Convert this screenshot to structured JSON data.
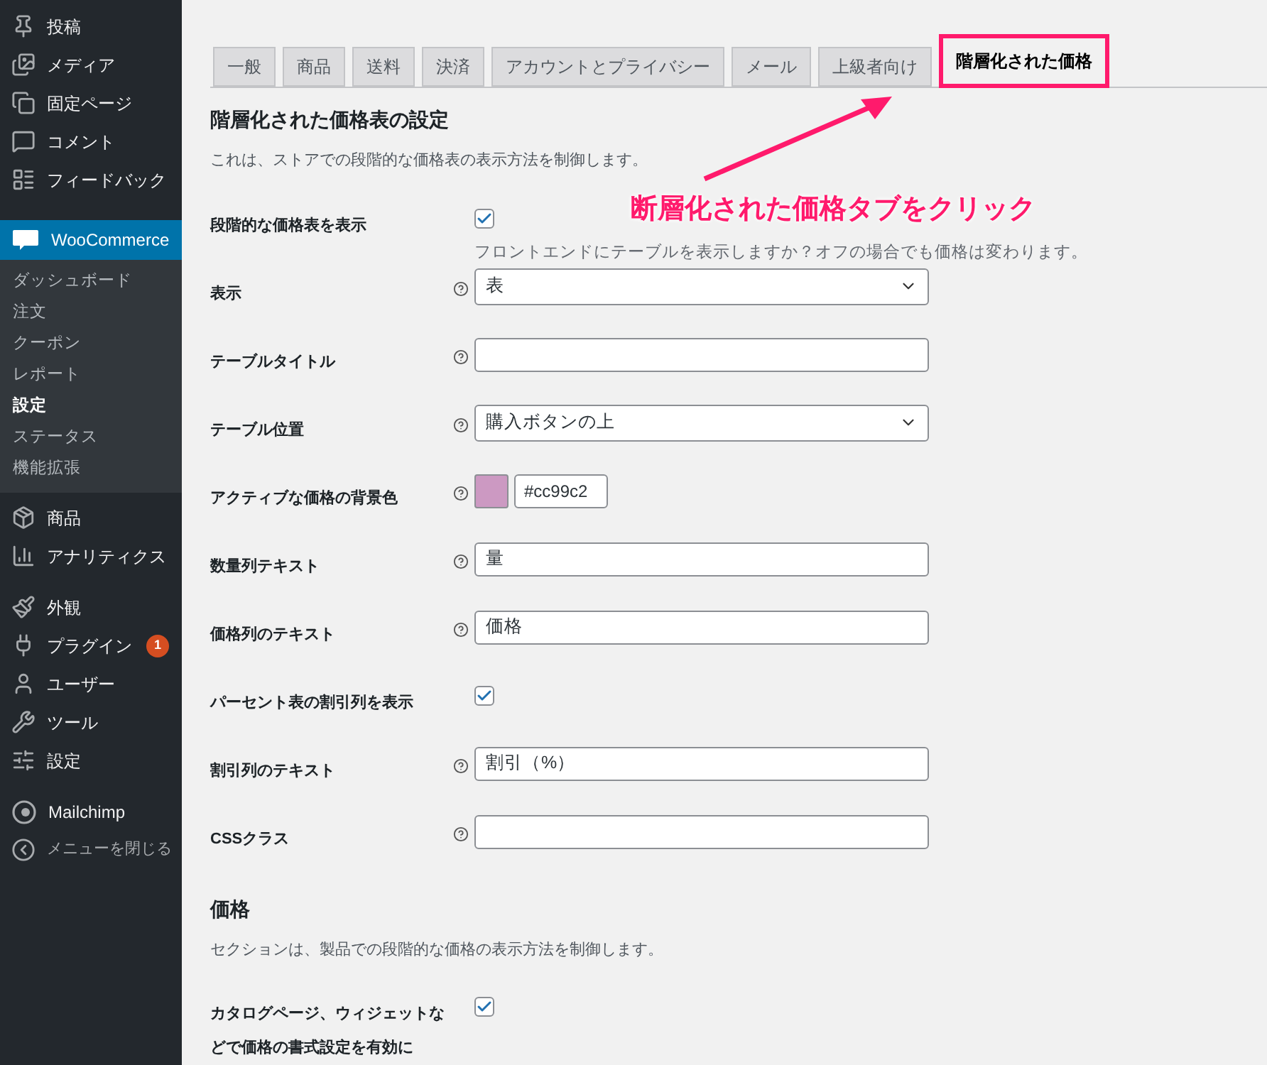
{
  "sidebar": {
    "items": [
      {
        "label": "投稿",
        "selected": false
      },
      {
        "label": "メディア",
        "selected": false
      },
      {
        "label": "固定ページ",
        "selected": false
      },
      {
        "label": "コメント",
        "selected": false
      },
      {
        "label": "フィードバック",
        "selected": false
      },
      {
        "label": "WooCommerce",
        "selected": true,
        "children": [
          {
            "label": "ダッシュボード",
            "selected": false
          },
          {
            "label": "注文",
            "selected": false
          },
          {
            "label": "クーポン",
            "selected": false
          },
          {
            "label": "レポート",
            "selected": false
          },
          {
            "label": "設定",
            "selected": true
          },
          {
            "label": "ステータス",
            "selected": false
          },
          {
            "label": "機能拡張",
            "selected": false
          }
        ]
      },
      {
        "label": "商品",
        "selected": false
      },
      {
        "label": "アナリティクス",
        "selected": false
      },
      {
        "label": "外観",
        "selected": false
      },
      {
        "label": "プラグイン",
        "selected": false,
        "badge": "1"
      },
      {
        "label": "ユーザー",
        "selected": false
      },
      {
        "label": "ツール",
        "selected": false
      },
      {
        "label": "設定",
        "selected": false
      },
      {
        "label": "Mailchimp",
        "selected": false
      },
      {
        "label": "メニューを閉じる",
        "selected": false,
        "dim": true
      }
    ]
  },
  "tabs": [
    {
      "label": "一般",
      "selected": false,
      "highlighted": false
    },
    {
      "label": "商品",
      "selected": false,
      "highlighted": false
    },
    {
      "label": "送料",
      "selected": false,
      "highlighted": false
    },
    {
      "label": "決済",
      "selected": false,
      "highlighted": false
    },
    {
      "label": "アカウントとプライバシー",
      "selected": false,
      "highlighted": false
    },
    {
      "label": "メール",
      "selected": false,
      "highlighted": false
    },
    {
      "label": "上級者向け",
      "selected": false,
      "highlighted": false
    },
    {
      "label": "階層化された価格",
      "selected": true,
      "highlighted": true
    }
  ],
  "callout": "断層化された価格タブをクリック",
  "sections": [
    {
      "title": "階層化された価格表の設定",
      "description": "これは、ストアでの段階的な価格表の表示方法を制御します。",
      "rows": [
        {
          "kind": "checkbox",
          "label": "段階的な価格表を表示",
          "checked": true,
          "help": false,
          "description": "フロントエンドにテーブルを表示しますか？オフの場合でも価格は変わります。"
        },
        {
          "kind": "select",
          "label": "表示",
          "help": true,
          "value": "表"
        },
        {
          "kind": "text",
          "label": "テーブルタイトル",
          "help": true
        },
        {
          "kind": "select",
          "label": "テーブル位置",
          "help": true,
          "value": "購入ボタンの上"
        },
        {
          "kind": "color",
          "label": "アクティブな価格の背景色",
          "help": true,
          "value": "#cc99c2",
          "color": "#cc99c2"
        },
        {
          "kind": "text",
          "label": "数量列テキスト",
          "help": true,
          "value": "量"
        },
        {
          "kind": "text",
          "label": "価格列のテキスト",
          "help": true,
          "value": "価格"
        },
        {
          "kind": "checkbox",
          "label": "パーセント表の割引列を表示",
          "checked": true,
          "help": false
        },
        {
          "kind": "text",
          "label": "割引列のテキスト",
          "help": true,
          "value": "割引（%）"
        },
        {
          "kind": "text",
          "label": "CSSクラス",
          "help": true
        }
      ]
    },
    {
      "title": "価格",
      "description": "セクションは、製品での段階的な価格の表示方法を制御します。",
      "rows": [
        {
          "kind": "checkbox",
          "label": "カタログページ、ウィジェットなどで価格の書式設定を有効に",
          "checked": true,
          "help": false
        }
      ]
    }
  ]
}
